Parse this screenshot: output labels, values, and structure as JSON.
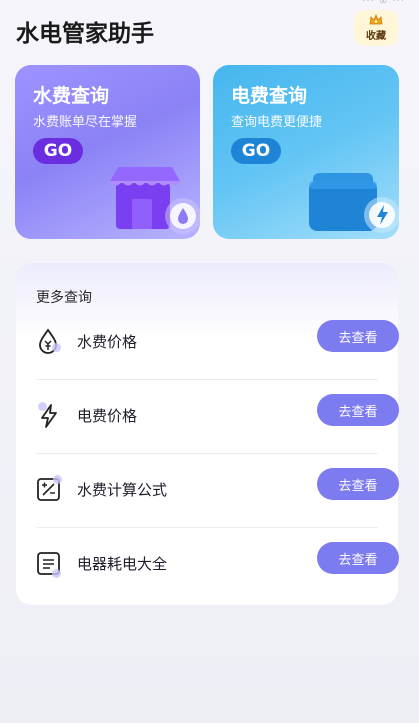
{
  "app": {
    "title": "水电管家助手",
    "status_partial": "··· ∞ ···"
  },
  "favorite": {
    "label": "收藏",
    "icon": "crown-icon"
  },
  "cards": {
    "water": {
      "title": "水费查询",
      "subtitle": "水费账单尽在掌握",
      "go": "GO",
      "icon": "shop-drop-icon"
    },
    "electric": {
      "title": "电费查询",
      "subtitle": "查询电费更便捷",
      "go": "GO",
      "icon": "wallet-bolt-icon"
    }
  },
  "more": {
    "title": "更多查询",
    "items": [
      {
        "label": "水费价格",
        "button": "去查看",
        "icon": "water-price-icon"
      },
      {
        "label": "电费价格",
        "button": "去查看",
        "icon": "bolt-icon"
      },
      {
        "label": "水费计算公式",
        "button": "去查看",
        "icon": "percent-icon"
      },
      {
        "label": "电器耗电大全",
        "button": "去查看",
        "icon": "list-icon"
      }
    ]
  },
  "colors": {
    "accent": "#7d7bf0",
    "water_card": "#9e93ff",
    "electric_card": "#46b6ee",
    "go_water": "#6a2ee0",
    "go_electric": "#1d84d6"
  }
}
